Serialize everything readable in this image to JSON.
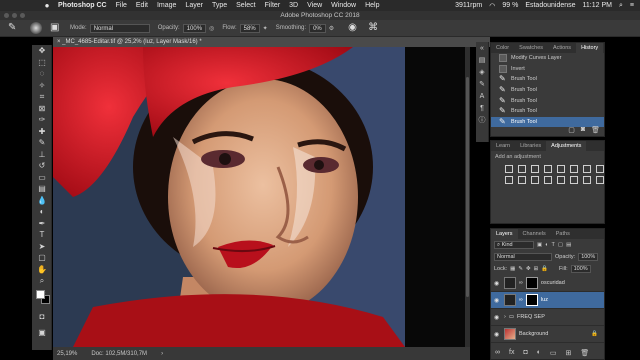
{
  "menubar": {
    "app": "Photoshop CC",
    "items": [
      "File",
      "Edit",
      "Image",
      "Layer",
      "Type",
      "Select",
      "Filter",
      "3D",
      "View",
      "Window",
      "Help"
    ],
    "battery": "99 %",
    "user": "Estadounidense",
    "time": "11:12 PM",
    "network": "3911rpm"
  },
  "window": {
    "title": "Adobe Photoshop CC 2018"
  },
  "options": {
    "mode_label": "Mode:",
    "mode_value": "Normal",
    "opacity_label": "Opacity:",
    "opacity_value": "100%",
    "flow_label": "Flow:",
    "flow_value": "58%",
    "smoothing_label": "Smoothing:",
    "smoothing_value": "0%"
  },
  "document": {
    "tab_title": "_MC_4685-Editar.tif @ 25,2% (luz, Layer Mask/16) *",
    "zoom": "25,19%",
    "doc_size": "Doc: 102,5M/310,7M"
  },
  "history_panel": {
    "tabs": [
      "Color",
      "Swatches",
      "Actions",
      "History"
    ],
    "active_tab": "History",
    "items": [
      {
        "label": "Modify Curves Layer",
        "type": "other"
      },
      {
        "label": "Invert",
        "type": "other"
      },
      {
        "label": "Brush Tool",
        "type": "brush"
      },
      {
        "label": "Brush Tool",
        "type": "brush"
      },
      {
        "label": "Brush Tool",
        "type": "brush"
      },
      {
        "label": "Brush Tool",
        "type": "brush"
      },
      {
        "label": "Brush Tool",
        "type": "brush"
      }
    ]
  },
  "adjust_panel": {
    "tabs": [
      "Learn",
      "Libraries",
      "Adjustments"
    ],
    "active_tab": "Adjustments",
    "add_label": "Add an adjustment"
  },
  "layers_panel": {
    "tabs": [
      "Layers",
      "Channels",
      "Paths"
    ],
    "active_tab": "Layers",
    "kind_label": "Kind",
    "blend_mode": "Normal",
    "opacity_label": "Opacity:",
    "opacity_value": "100%",
    "lock_label": "Lock:",
    "fill_label": "Fill:",
    "fill_value": "100%",
    "layers": [
      {
        "name": "oscuridad",
        "active": false,
        "kind": "adjust"
      },
      {
        "name": "luz",
        "active": true,
        "kind": "adjust"
      },
      {
        "name": "FREQ SEP",
        "active": false,
        "kind": "group"
      },
      {
        "name": "Background",
        "active": false,
        "kind": "photo"
      }
    ]
  },
  "colors": {
    "accent": "#3f6a9e",
    "beret": "#d81420",
    "lips": "#b8101c",
    "skin": "#e2ad88"
  }
}
